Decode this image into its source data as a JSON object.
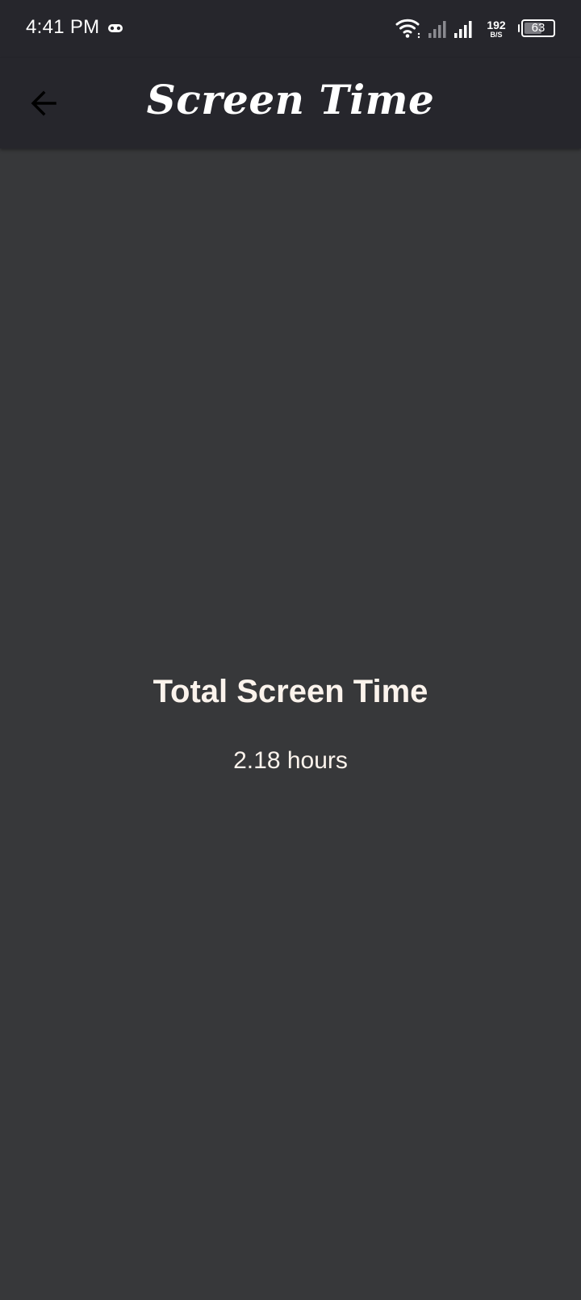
{
  "status_bar": {
    "time": "4:41 PM",
    "net_speed_value": "192",
    "net_speed_unit": "B/S",
    "battery_level": "63",
    "battery_fraction": 0.63,
    "icons": [
      "gamepad-icon",
      "wifi-icon",
      "signal-icon-sim1",
      "signal-icon-sim2",
      "battery-icon"
    ]
  },
  "app_bar": {
    "title": "Screen Time",
    "back_icon": "arrow-left-icon"
  },
  "summary": {
    "title": "Total Screen Time",
    "value": "2.18 hours"
  },
  "colors": {
    "background": "#37383a",
    "bar_background": "#26262c",
    "text": "#fbf3ec"
  }
}
